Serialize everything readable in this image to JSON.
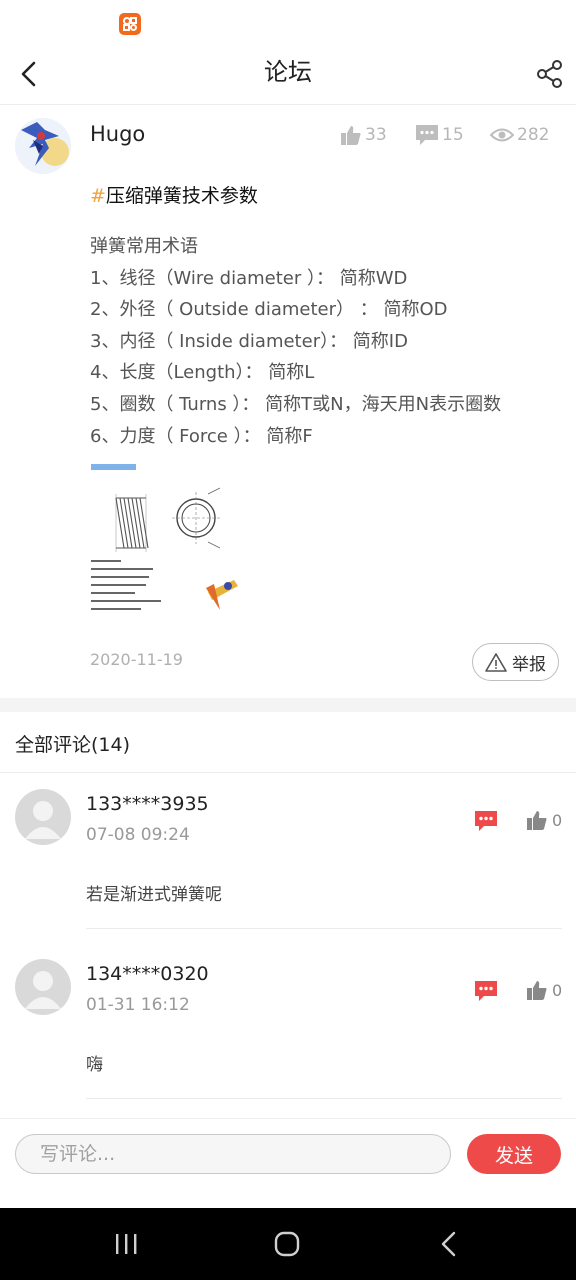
{
  "header": {
    "title": "论坛"
  },
  "post": {
    "author": "Hugo",
    "likes": "33",
    "comments": "15",
    "views": "282",
    "title_hash": "#",
    "title": "压缩弹簧技术参数",
    "lines": [
      "弹簧常用术语",
      "1、线径（Wire diameter ）：  简称WD",
      "2、外径（ Outside diameter）  ：  简称OD",
      "3、内径（ Inside diameter）：  简称ID",
      "4、长度（Length）：  简称L",
      "5、圈数（ Turns ）：  简称T或N，海天用N表示圈数",
      "6、力度（ Force ）：  简称F"
    ],
    "date": "2020-11-19",
    "report_label": "举报"
  },
  "comments_section": {
    "title": "全部评论(14)"
  },
  "comments": [
    {
      "user": "133****3935",
      "time": "07-08 09:24",
      "text": "若是渐进式弹簧呢",
      "likes": "0"
    },
    {
      "user": "134****0320",
      "time": "01-31 16:12",
      "text": "嗨",
      "likes": "0"
    }
  ],
  "comment_bar": {
    "placeholder": "写评论...",
    "send_label": "发送"
  },
  "colors": {
    "accent_red": "#ef4a4a",
    "hash_orange": "#f2a33a",
    "app_icon": "#f26b1d"
  },
  "icons": [
    "back-icon",
    "share-icon",
    "thumbs-up-icon",
    "comment-icon",
    "eye-icon",
    "warning-icon",
    "reply-icon",
    "recent-apps-icon",
    "home-icon",
    "nav-back-icon"
  ]
}
